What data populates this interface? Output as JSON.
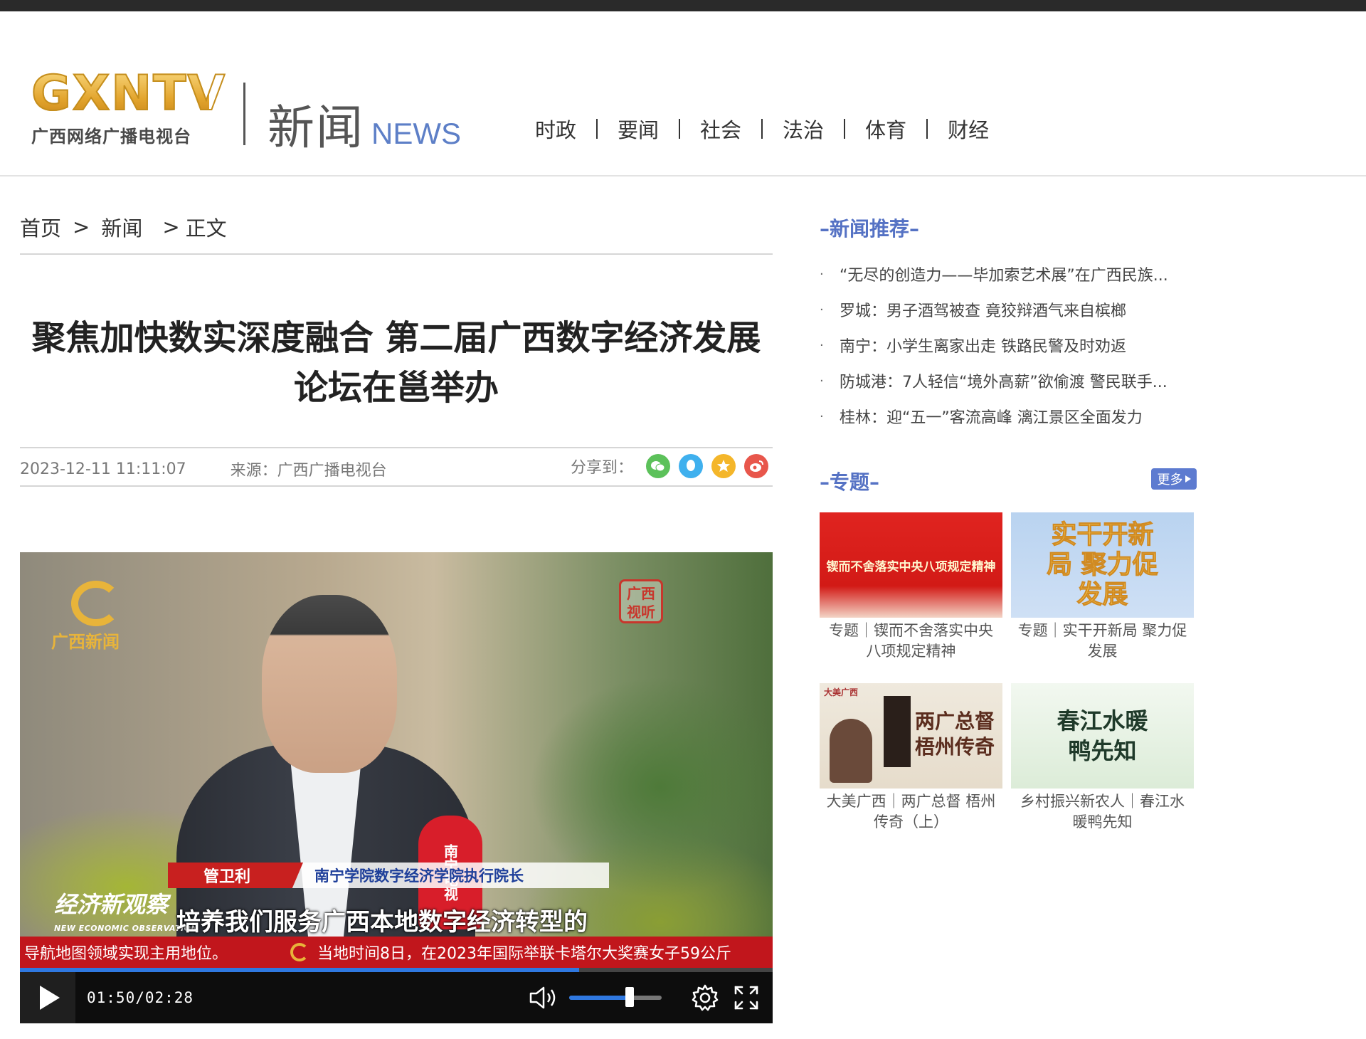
{
  "header": {
    "logo_mark": "GXNTV",
    "logo_sub": "广西网络广播电视台",
    "section_zh": "新闻",
    "section_en": "NEWS",
    "nav": [
      "时政",
      "要闻",
      "社会",
      "法治",
      "体育",
      "财经"
    ]
  },
  "breadcrumb": {
    "home": "首页",
    "news": "新闻",
    "current": "正文",
    "separator": ">"
  },
  "article": {
    "title": "聚焦加快数实深度融合 第二届广西数字经济发展论坛在邕举办",
    "date": "2023-12-11 11:11:07",
    "source": "来源：广西广播电视台",
    "share_label": "分享到："
  },
  "share_icons": [
    {
      "icon": "wechat-icon",
      "color": "#5cc15a"
    },
    {
      "icon": "qq-icon",
      "color": "#3fb0ee"
    },
    {
      "icon": "qzone-icon",
      "color": "#f4b62a"
    },
    {
      "icon": "weibo-icon",
      "color": "#e8564b"
    }
  ],
  "video": {
    "channel_logo_text": "广西新闻",
    "seal_text": "广西视听",
    "interviewee_name": "管卫利",
    "interviewee_role": "南宁学院数字经济学院执行院长",
    "program_name": "经济新观察",
    "program_name_en": "NEW ECONOMIC OBSERVATION",
    "mic_label": "南宁电视",
    "subtitle": "培养我们服务广西本地数字经济转型的",
    "ticker_left": "导航地图领域实现主用地位。",
    "ticker_right": "当地时间8日，在2023年国际举联卡塔尔大奖赛女子59公斤",
    "current_time": "01:50",
    "duration": "02:28",
    "time_display": "01:50/02:28",
    "progress_fraction": 0.743,
    "volume_fraction": 0.65,
    "accent_color": "#2f78e0"
  },
  "sidebar": {
    "recommend_title": "–新闻推荐–",
    "recommend_items": [
      "“无尽的创造力——毕加索艺术展”在广西民族...",
      "罗城：男子酒驾被查 竟狡辩酒气来自槟榔",
      "南宁：小学生离家出走 铁路民警及时劝返",
      "防城港：7人轻信“境外高薪”欲偷渡 警民联手...",
      "桂林：迎“五一”客流高峰 漓江景区全面发力"
    ],
    "bullet": "·",
    "topic_title": "–专题–",
    "more_label": "更多",
    "topics": [
      {
        "image_text": "锲而不舍落实中央八项规定精神",
        "caption": "专题｜锲而不舍落实中央八项规定精神"
      },
      {
        "image_text": "实干开新局 聚力促发展",
        "caption": "专题｜实干开新局 聚力促发展"
      },
      {
        "image_text": "两广总督 梧州传奇",
        "badge": "大美广西",
        "caption": "大美广西｜两广总督 梧州传奇（上）"
      },
      {
        "image_text": "春江水暖 鸭先知",
        "caption": "乡村振兴新农人｜春江水暖鸭先知"
      }
    ]
  },
  "colors": {
    "brand_blue": "#5572c4",
    "logo_gold": "#e8b43a",
    "ticker_red": "#c1161c"
  }
}
